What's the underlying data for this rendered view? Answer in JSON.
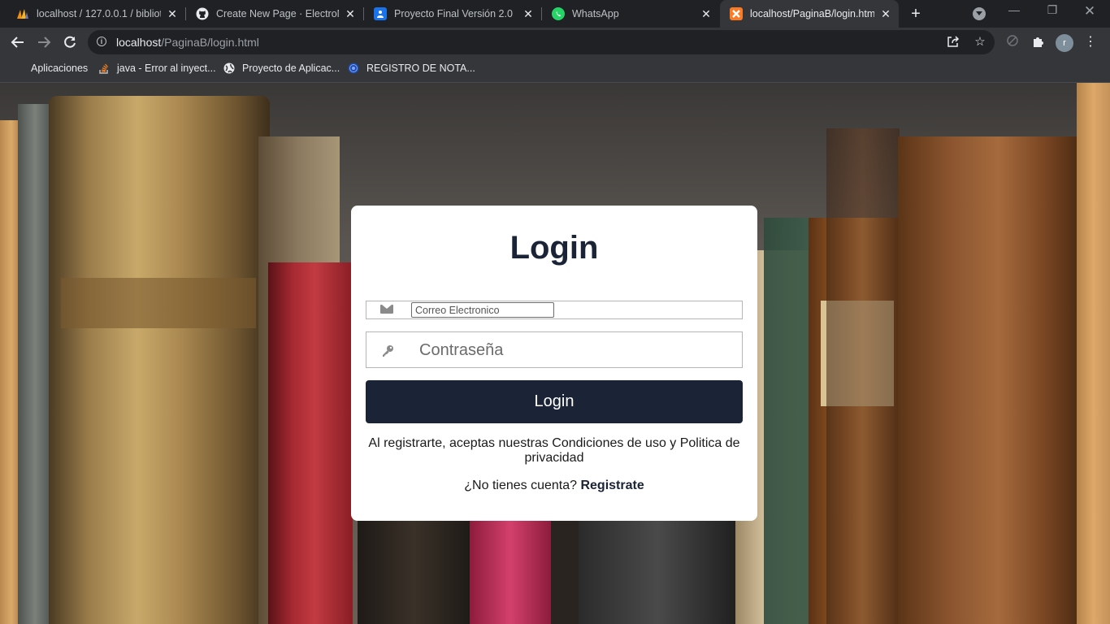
{
  "browser": {
    "tabs": [
      {
        "label": "localhost / 127.0.0.1 / bibliote",
        "favicon": "phpmyadmin-icon",
        "active": false
      },
      {
        "label": "Create New Page · ElectroMa",
        "favicon": "github-icon",
        "active": false
      },
      {
        "label": "Proyecto Final Versión 2.0",
        "favicon": "google-forms-icon",
        "active": false
      },
      {
        "label": "WhatsApp",
        "favicon": "whatsapp-icon",
        "active": false
      },
      {
        "label": "localhost/PaginaB/login.html",
        "favicon": "xampp-icon",
        "active": true
      }
    ],
    "address": {
      "host": "localhost",
      "path": "/PaginaB/login.html"
    },
    "profile_initial": "r",
    "bookmarks": [
      {
        "label": "Aplicaciones",
        "icon": "apps-grid-icon"
      },
      {
        "label": "java - Error al inyect...",
        "icon": "stackoverflow-icon"
      },
      {
        "label": "Proyecto de Aplicac...",
        "icon": "globe-icon"
      },
      {
        "label": "REGISTRO DE NOTA...",
        "icon": "web-icon"
      }
    ]
  },
  "login": {
    "title": "Login",
    "email_placeholder": "Correo Electronico",
    "password_placeholder": "Contraseña",
    "button_label": "Login",
    "terms_text": "Al registrarte, aceptas nuestras Condiciones de uso y Politica de privacidad",
    "signup_prompt": "¿No tienes cuenta?",
    "signup_link": "Registrate"
  },
  "colors": {
    "primary": "#1b2336",
    "chrome_dark": "#202124",
    "chrome_toolbar": "#35363a"
  }
}
